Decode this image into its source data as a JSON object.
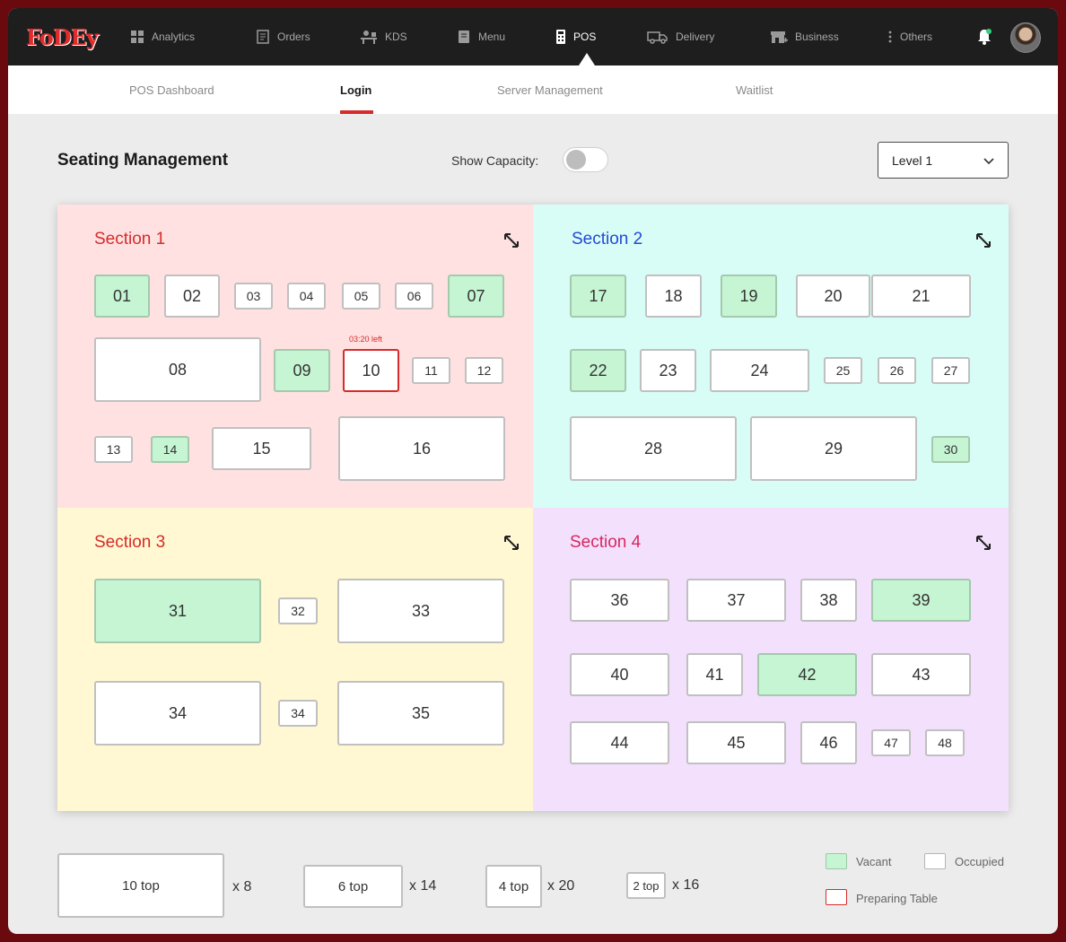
{
  "app": {
    "logo": "FoDEy"
  },
  "nav": {
    "items": [
      {
        "label": "Analytics",
        "icon": "analytics-icon"
      },
      {
        "label": "Orders",
        "icon": "orders-icon"
      },
      {
        "label": "KDS",
        "icon": "kds-icon"
      },
      {
        "label": "Menu",
        "icon": "menu-icon"
      },
      {
        "label": "POS",
        "icon": "pos-icon",
        "active": true
      },
      {
        "label": "Delivery",
        "icon": "delivery-icon"
      },
      {
        "label": "Business",
        "icon": "business-icon"
      },
      {
        "label": "Others",
        "icon": "more-vertical-icon"
      }
    ]
  },
  "subnav": {
    "tabs": [
      {
        "label": "POS Dashboard"
      },
      {
        "label": "Login",
        "active": true
      },
      {
        "label": "Server Management"
      },
      {
        "label": "Waitlist"
      }
    ]
  },
  "page": {
    "title": "Seating Management",
    "capacity_label": "Show Capacity:",
    "capacity_on": false,
    "level": "Level 1"
  },
  "sections": [
    {
      "title": "Section 1",
      "color": "#ffe1e1",
      "title_color": "#d62b2b",
      "tables": [
        {
          "label": "01",
          "status": "vacant"
        },
        {
          "label": "02",
          "status": "occupied"
        },
        {
          "label": "03",
          "status": "occupied"
        },
        {
          "label": "04",
          "status": "occupied"
        },
        {
          "label": "05",
          "status": "occupied"
        },
        {
          "label": "06",
          "status": "occupied"
        },
        {
          "label": "07",
          "status": "vacant"
        },
        {
          "label": "08",
          "status": "occupied"
        },
        {
          "label": "09",
          "status": "vacant"
        },
        {
          "label": "10",
          "status": "preparing",
          "timer": "03:20 left"
        },
        {
          "label": "11",
          "status": "occupied"
        },
        {
          "label": "12",
          "status": "occupied"
        },
        {
          "label": "13",
          "status": "occupied"
        },
        {
          "label": "14",
          "status": "vacant"
        },
        {
          "label": "15",
          "status": "occupied"
        },
        {
          "label": "16",
          "status": "occupied"
        }
      ]
    },
    {
      "title": "Section 2",
      "color": "#d8fcf6",
      "title_color": "#2449d6",
      "tables": [
        {
          "label": "17",
          "status": "vacant"
        },
        {
          "label": "18",
          "status": "occupied"
        },
        {
          "label": "19",
          "status": "vacant"
        },
        {
          "label": "20",
          "status": "occupied"
        },
        {
          "label": "21",
          "status": "occupied"
        },
        {
          "label": "22",
          "status": "vacant"
        },
        {
          "label": "23",
          "status": "occupied"
        },
        {
          "label": "24",
          "status": "occupied"
        },
        {
          "label": "25",
          "status": "occupied"
        },
        {
          "label": "26",
          "status": "occupied"
        },
        {
          "label": "27",
          "status": "occupied"
        },
        {
          "label": "28",
          "status": "occupied"
        },
        {
          "label": "29",
          "status": "occupied"
        },
        {
          "label": "30",
          "status": "vacant"
        }
      ]
    },
    {
      "title": "Section 3",
      "color": "#fff8d2",
      "title_color": "#d62b2b",
      "tables": [
        {
          "label": "31",
          "status": "vacant"
        },
        {
          "label": "32",
          "status": "occupied"
        },
        {
          "label": "33",
          "status": "occupied"
        },
        {
          "label": "34",
          "status": "occupied"
        },
        {
          "label": "34",
          "status": "occupied"
        },
        {
          "label": "35",
          "status": "occupied"
        }
      ]
    },
    {
      "title": "Section 4",
      "color": "#f3e0fd",
      "title_color": "#d6285f",
      "tables": [
        {
          "label": "36",
          "status": "occupied"
        },
        {
          "label": "37",
          "status": "occupied"
        },
        {
          "label": "38",
          "status": "occupied"
        },
        {
          "label": "39",
          "status": "vacant"
        },
        {
          "label": "40",
          "status": "occupied"
        },
        {
          "label": "41",
          "status": "occupied"
        },
        {
          "label": "42",
          "status": "vacant"
        },
        {
          "label": "43",
          "status": "occupied"
        },
        {
          "label": "44",
          "status": "occupied"
        },
        {
          "label": "45",
          "status": "occupied"
        },
        {
          "label": "46",
          "status": "occupied"
        },
        {
          "label": "47",
          "status": "occupied"
        },
        {
          "label": "48",
          "status": "occupied"
        }
      ]
    }
  ],
  "capacity_legend": [
    {
      "label": "10 top",
      "count": "x 8"
    },
    {
      "label": "6 top",
      "count": "x 14"
    },
    {
      "label": "4 top",
      "count": "x 20"
    },
    {
      "label": "2 top",
      "count": "x 16"
    }
  ],
  "status_key": [
    {
      "label": "Vacant",
      "color": "#c6f5d4"
    },
    {
      "label": "Occupied",
      "color": "#ffffff"
    },
    {
      "label": "Preparing Table",
      "color": "#d62b2b"
    }
  ]
}
